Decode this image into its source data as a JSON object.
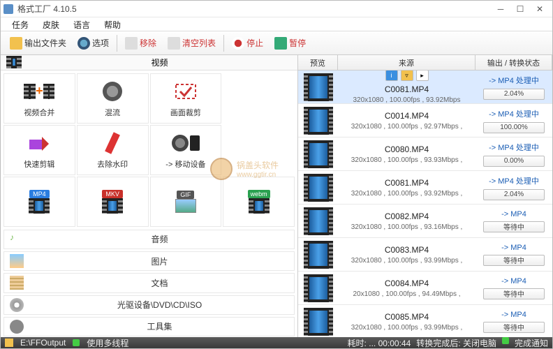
{
  "window": {
    "title": "格式工厂 4.10.5"
  },
  "menubar": [
    "任务",
    "皮肤",
    "语言",
    "帮助"
  ],
  "toolbar": {
    "output_folder": "输出文件夹",
    "options": "选项",
    "remove": "移除",
    "clear": "清空列表",
    "stop": "停止",
    "pause": "暂停"
  },
  "categories": {
    "video_label": "视频",
    "grid": [
      {
        "label": "视频合并"
      },
      {
        "label": "混流"
      },
      {
        "label": "画面裁剪"
      },
      {
        "label": ""
      },
      {
        "label": "快速剪辑"
      },
      {
        "label": "去除水印"
      },
      {
        "label": "-> 移动设备"
      },
      {
        "label": ""
      },
      {
        "label": "MP4",
        "badge": "MP4"
      },
      {
        "label": "",
        "badge": "MKV"
      },
      {
        "label": "",
        "badge": "GIF"
      },
      {
        "label": "",
        "badge": "webm"
      }
    ],
    "rows": [
      {
        "label": "音频"
      },
      {
        "label": "图片"
      },
      {
        "label": "文档"
      },
      {
        "label": "光驱设备\\DVD\\CD\\ISO"
      },
      {
        "label": "工具集"
      }
    ]
  },
  "queue": {
    "headers": {
      "preview": "预览",
      "source": "来源",
      "status": "输出 / 转换状态"
    },
    "items": [
      {
        "file": "C0081.MP4",
        "meta": "320x1080 , 100.00fps , 93.92Mbps",
        "status": "-> MP4 处理中",
        "progress": "2.04%",
        "selected": true,
        "btns": true
      },
      {
        "file": "C0014.MP4",
        "meta": "320x1080 , 100.00fps , 92.97Mbps ,",
        "status": "-> MP4 处理中",
        "progress": "100.00%"
      },
      {
        "file": "C0080.MP4",
        "meta": "320x1080 , 100.00fps , 93.93Mbps ,",
        "status": "-> MP4 处理中",
        "progress": "0.00%"
      },
      {
        "file": "C0081.MP4",
        "meta": "320x1080 , 100.00fps , 93.92Mbps ,",
        "status": "-> MP4 处理中",
        "progress": "2.04%"
      },
      {
        "file": "C0082.MP4",
        "meta": "320x1080 , 100.00fps , 93.16Mbps ,",
        "status": "-> MP4",
        "progress": "等待中"
      },
      {
        "file": "C0083.MP4",
        "meta": "320x1080 , 100.00fps , 93.99Mbps ,",
        "status": "-> MP4",
        "progress": "等待中"
      },
      {
        "file": "C0084.MP4",
        "meta": "20x1080 , 100.00fps , 94.49Mbps ,",
        "status": "-> MP4",
        "progress": "等待中"
      },
      {
        "file": "C0085.MP4",
        "meta": "320x1080 , 100.00fps , 93.99Mbps ,",
        "status": "-> MP4",
        "progress": "等待中"
      }
    ]
  },
  "statusbar": {
    "output_path": "E:\\FFOutput",
    "multithread": "使用多线程",
    "elapsed_label": "耗时:",
    "elapsed": "... 00:00:44",
    "after_label": "转换完成后:",
    "after_value": "关闭电脑",
    "notify": "完成通知"
  },
  "watermark": {
    "title": "锅盖头软件",
    "url": "www.ggtir.cn"
  }
}
